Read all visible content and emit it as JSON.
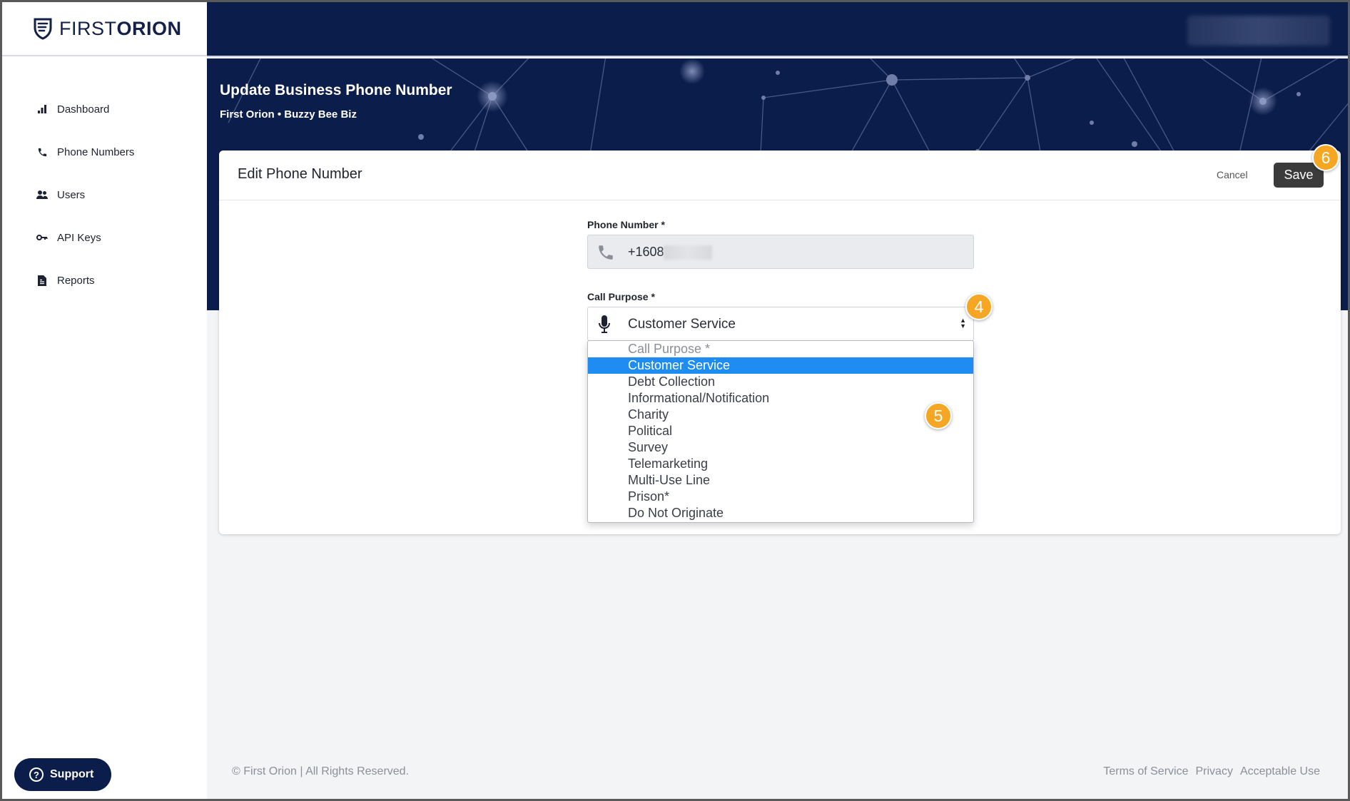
{
  "brand": {
    "light": "FIRST",
    "bold": "ORION"
  },
  "nav": [
    {
      "label": "Dashboard",
      "icon": "bar-chart-icon"
    },
    {
      "label": "Phone Numbers",
      "icon": "phone-icon"
    },
    {
      "label": "Users",
      "icon": "users-icon"
    },
    {
      "label": "API Keys",
      "icon": "key-icon"
    },
    {
      "label": "Reports",
      "icon": "report-icon"
    }
  ],
  "support_label": "Support",
  "page": {
    "title": "Update Business Phone Number",
    "breadcrumb": "First Orion • Buzzy Bee Biz"
  },
  "card": {
    "title": "Edit Phone Number",
    "cancel_label": "Cancel",
    "save_label": "Save"
  },
  "form": {
    "phone_label": "Phone Number *",
    "phone_value": "+1608",
    "purpose_label": "Call Purpose *",
    "purpose_value": "Customer Service",
    "options": [
      "Call Purpose *",
      "Customer Service",
      "Debt Collection",
      "Informational/Notification",
      "Charity",
      "Political",
      "Survey",
      "Telemarketing",
      "Multi-Use Line",
      "Prison*",
      "Do Not Originate"
    ],
    "selected_index": 1
  },
  "badges": {
    "b4": "4",
    "b5": "5",
    "b6": "6"
  },
  "footer": {
    "copyright": "© First Orion | All Rights Reserved.",
    "links": [
      "Terms of Service",
      "Privacy",
      "Acceptable Use"
    ]
  },
  "colors": {
    "navy": "#0b1d4b",
    "accent_select": "#1f8cf1",
    "badge": "#f5a623"
  }
}
